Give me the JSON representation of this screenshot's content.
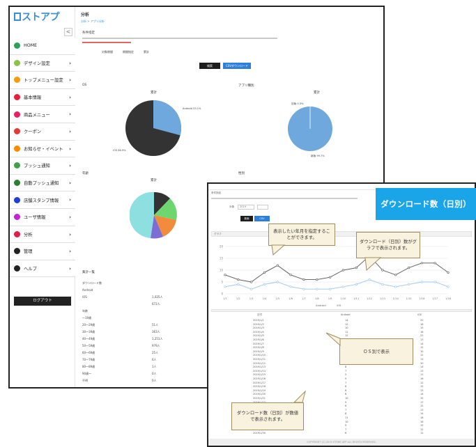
{
  "colors": {
    "accent_blue": "#1aa5e8",
    "callout_bg": "#f8f2de",
    "pie_blue": "#6fa8dc",
    "pie_dark": "#333333"
  },
  "back": {
    "logo": "ストアプ",
    "sidebar_toggle": "<",
    "nav": [
      {
        "label": "HOME",
        "color": "#2e9e5b",
        "chev": ""
      },
      {
        "label": "デザイン設定",
        "color": "#8bc34a",
        "chev": "›"
      },
      {
        "label": "トップメニュー設定",
        "color": "#f39c12",
        "chev": "›"
      },
      {
        "label": "基本情報",
        "color": "#e91e3c",
        "chev": "›"
      },
      {
        "label": "商品メニュー",
        "color": "#e91e63",
        "chev": "›"
      },
      {
        "label": "クーポン",
        "color": "#e53935",
        "chev": "›"
      },
      {
        "label": "お知らせ・イベント",
        "color": "#fb8c00",
        "chev": "›"
      },
      {
        "label": "プッシュ通知",
        "color": "#43a047",
        "chev": "›"
      },
      {
        "label": "自動プッシュ通知",
        "color": "#2e7d32",
        "chev": "›"
      },
      {
        "label": "店舗スタンプ情報",
        "color": "#1e3fd6",
        "chev": "›"
      },
      {
        "label": "ユーザ情報",
        "color": "#c026d3",
        "chev": "›"
      },
      {
        "label": "分析",
        "color": "#e11d48",
        "chev": "›"
      },
      {
        "label": "管理",
        "color": "#222222",
        "chev": "›"
      },
      {
        "label": "ヘルプ",
        "color": "#222222",
        "chev": "›"
      }
    ],
    "logout": "ログアウト",
    "page_title": "分析",
    "breadcrumb": "分析 > アプリ分析",
    "sections": {
      "conditions": "条件指定",
      "os": "OS",
      "age": "年齢",
      "gender": "性別",
      "app_version": "アプリ種別",
      "table": "集計一覧"
    },
    "options": [
      "対象期間",
      "期間指定",
      "累計"
    ],
    "btn_search": "検索",
    "btn_csv": "CSVダウンロード",
    "pie_titles": [
      "累計",
      "累計",
      "累計",
      "累計"
    ],
    "pie1_legend": [
      "Android 33.1%",
      "iOS 66.9%"
    ],
    "pie2_legend": [
      "旧版 0.3%",
      "新版 99.7%"
    ],
    "table_left": [
      "ダウンロード数",
      "Android",
      "iOS",
      "",
      "年齢",
      "～19歳",
      "20～29歳",
      "30～39歳",
      "40～49歳",
      "50～59歳",
      "60～69歳",
      "70～79歳",
      "80～89歳",
      "90歳～",
      "不明"
    ],
    "table_right": [
      "",
      "",
      "1,025人",
      "672人",
      "",
      "",
      "51人",
      "363人",
      "1,251人",
      "979人",
      "25人",
      "6人",
      "1人",
      "0人",
      "0人"
    ]
  },
  "front": {
    "section": "条件指定",
    "month_label": "対象",
    "month_value": "2019",
    "btn_search": "検索",
    "btn_csv": "CSV",
    "panel_title": "グラフ",
    "legend": [
      "Android",
      "iOS"
    ],
    "col_headers": [
      "日付",
      "Android",
      "iOS"
    ],
    "dates": [
      "2019/1/1",
      "2019/1/2",
      "2019/1/3",
      "2019/1/4",
      "2019/1/5",
      "2019/1/6",
      "2019/1/7",
      "2019/1/8",
      "2019/1/9",
      "2019/1/10",
      "2019/1/11",
      "2019/1/12",
      "2019/1/13",
      "2019/1/14",
      "2019/1/15",
      "2019/1/16",
      "2019/1/17",
      "2019/1/18",
      "2019/1/19",
      "2019/1/20",
      "2019/1/21",
      "2019/1/22",
      "2019/1/23",
      "2019/1/24",
      "2019/1/25",
      "2019/1/26",
      "2019/1/27",
      "2019/1/28",
      "2019/1/29",
      "2019/1/30",
      "2019/1/31"
    ],
    "android": [
      14,
      12,
      10,
      11,
      12,
      8,
      9,
      6,
      4,
      6,
      5,
      6,
      8,
      7,
      5,
      9,
      7,
      6,
      6,
      8,
      10,
      9,
      6,
      7,
      8,
      11,
      10,
      9,
      7,
      6,
      8
    ],
    "ios": [
      20,
      18,
      15,
      16,
      22,
      13,
      14,
      12,
      10,
      12,
      11,
      10,
      14,
      13,
      11,
      16,
      12,
      12,
      13,
      14,
      15,
      17,
      12,
      13,
      14,
      18,
      16,
      15,
      12,
      11,
      14
    ],
    "footer": "COPYRIGHT (C) 2019 STORE APP ALL RIGHTS RESERVED."
  },
  "banner": "ダウンロード数（日別）",
  "callouts": {
    "month": "表示したい年月を指定することができます。",
    "graph": "ダウンロード（日別）数がグラフで表示されます。",
    "os": "ＯＳ別で表示",
    "count": "ダウンロード数（日別）が数値で表示されます。"
  },
  "chart_data": {
    "type": "line",
    "title": "",
    "xlabel": "",
    "ylabel": "",
    "categories": [
      "1/1",
      "1/2",
      "1/3",
      "1/4",
      "1/5",
      "1/6",
      "1/7",
      "1/8",
      "1/9",
      "1/10",
      "1/11",
      "1/12",
      "1/13",
      "1/14",
      "1/15",
      "1/16",
      "1/17",
      "1/18"
    ],
    "series": [
      {
        "name": "Android",
        "values": [
          3,
          4,
          2,
          4,
          5,
          3,
          2,
          2,
          2,
          3,
          4,
          6,
          4,
          3,
          4,
          5,
          5,
          3
        ]
      },
      {
        "name": "iOS",
        "values": [
          8,
          6,
          5,
          9,
          12,
          8,
          6,
          6,
          7,
          10,
          11,
          16,
          10,
          8,
          11,
          13,
          13,
          9
        ]
      }
    ],
    "ylim": [
      0,
      20
    ],
    "grid": true,
    "legend": "bottom"
  }
}
